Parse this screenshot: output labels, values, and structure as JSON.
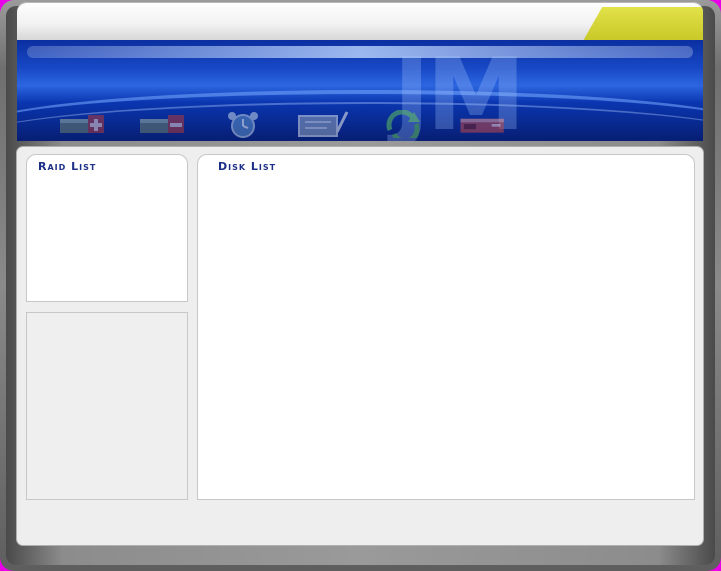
{
  "window": {
    "background_color": "#e800e8",
    "accent_color": "#d4d43a",
    "banner_color": "#1848c6"
  },
  "banner": {
    "logo_text": "JM",
    "tools": [
      {
        "icon": "add-raid-icon"
      },
      {
        "icon": "delete-raid-icon"
      },
      {
        "icon": "alarm-clock-icon"
      },
      {
        "icon": "edit-icon"
      },
      {
        "icon": "refresh-icon"
      },
      {
        "icon": "drive-icon"
      }
    ]
  },
  "raid_list": {
    "title": "Raid List"
  },
  "disk_list": {
    "title": "Disk List"
  }
}
